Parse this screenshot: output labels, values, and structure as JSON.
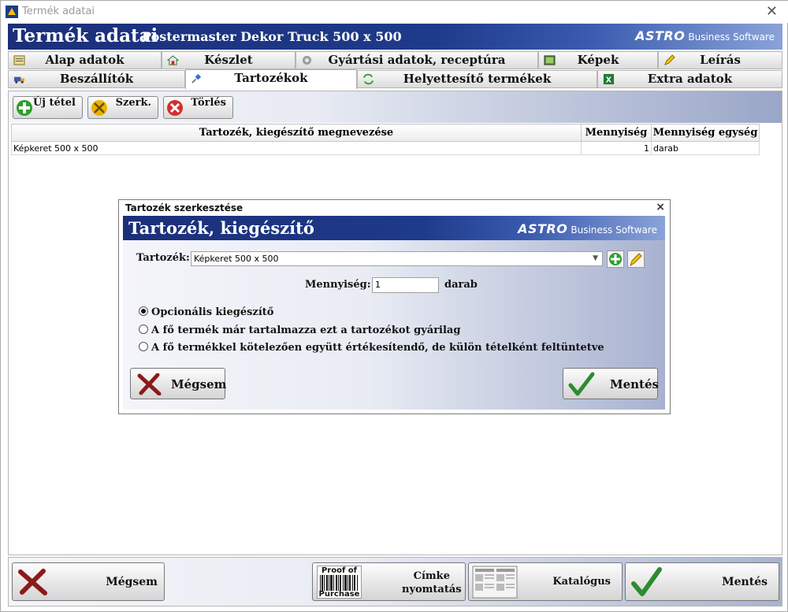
{
  "window": {
    "title": "Termék adatai"
  },
  "header": {
    "title": "Termék adatai",
    "product_name": "Postermaster Dekor Truck  500 x 500"
  },
  "brand": {
    "name": "ASTRO",
    "sub": "Business Software"
  },
  "tabs_row1": [
    {
      "label": "Alap adatok",
      "icon": "form-icon"
    },
    {
      "label": "Készlet",
      "icon": "house-icon"
    },
    {
      "label": "Gyártási adatok, receptúra",
      "icon": "gear-icon"
    },
    {
      "label": "Képek",
      "icon": "picture-icon"
    },
    {
      "label": "Leírás",
      "icon": "pencil-icon"
    }
  ],
  "tabs_row2": [
    {
      "label": "Beszállítók",
      "icon": "truck-icon"
    },
    {
      "label": "Tartozékok",
      "icon": "pin-icon",
      "active": true
    },
    {
      "label": "Helyettesítő termékek",
      "icon": "swap-icon"
    },
    {
      "label": "Extra adatok",
      "icon": "excel-icon"
    }
  ],
  "toolbar": {
    "new_label": "Új tétel",
    "edit_label": "Szerk.",
    "delete_label": "Törlés"
  },
  "grid": {
    "columns": [
      "Tartozék, kiegészítő megnevezése",
      "Mennyiség",
      "Mennyiség egység"
    ],
    "rows": [
      {
        "name": "Képkeret  500 x 500",
        "qty": "1",
        "unit": "darab"
      }
    ]
  },
  "dialog": {
    "title": "Tartozék szerkesztése",
    "header": "Tartozék, kiegészítő",
    "accessory_label": "Tartozék:",
    "accessory_value": "Képkeret  500 x 500",
    "qty_label": "Mennyiség:",
    "qty_value": "1",
    "qty_unit": "darab",
    "options": [
      {
        "label": "Opcionális kiegészítő",
        "selected": true
      },
      {
        "label": "A fő termék már tartalmazza ezt a tartozékot gyárilag",
        "selected": false
      },
      {
        "label": "A fő termékkel kötelezően együtt értékesítendő, de külön tételként feltüntetve",
        "selected": false
      }
    ],
    "cancel_label": "Mégsem",
    "save_label": "Mentés"
  },
  "bottom": {
    "cancel_label": "Mégsem",
    "label_print_line1": "Címke",
    "label_print_line2": "nyomtatás",
    "barcode_text_top": "Proof of",
    "barcode_text_bottom": "Purchase",
    "catalog_label": "Katalógus",
    "save_label": "Mentés"
  },
  "colors": {
    "banner": "#1e3a8a",
    "accent_green": "#2e9e2e",
    "accent_red": "#c62828"
  }
}
